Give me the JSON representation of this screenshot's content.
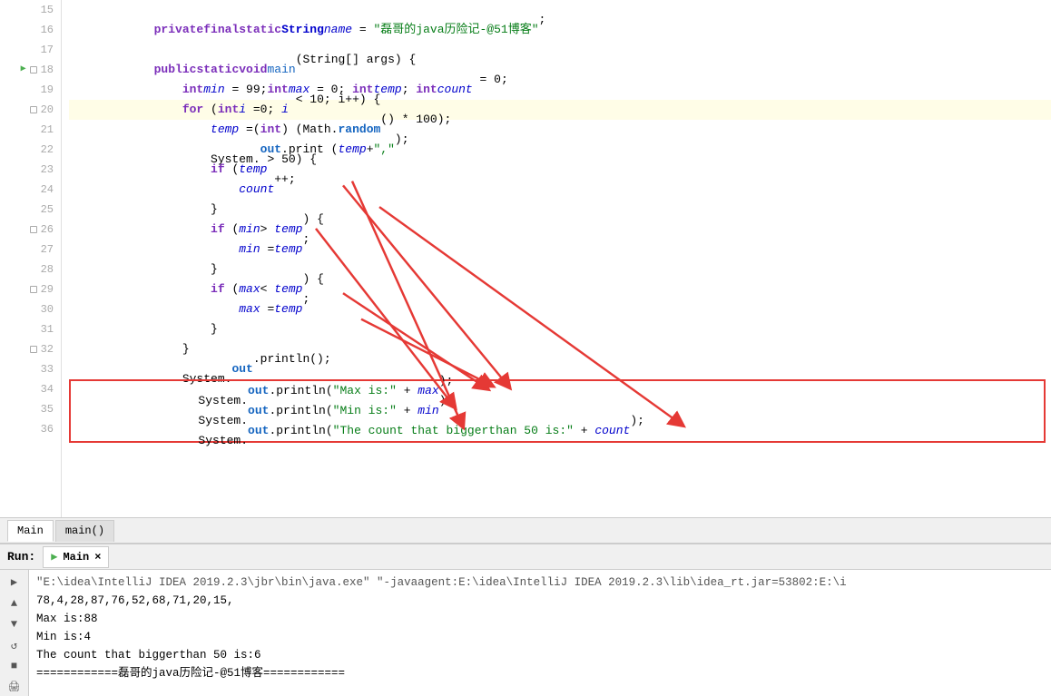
{
  "editor": {
    "lines": [
      {
        "num": 15,
        "content": "",
        "markers": []
      },
      {
        "num": 16,
        "content": "    private final static String name = \"磊哥的java历险记-@51博客\";",
        "markers": [],
        "highlighted": false
      },
      {
        "num": 17,
        "content": "",
        "markers": []
      },
      {
        "num": 18,
        "content": "    public static void main(String[] args) {",
        "markers": [
          "arrow-green"
        ],
        "highlighted": false
      },
      {
        "num": 19,
        "content": "        int min = 99;int max = 0; int temp; int count = 0;",
        "markers": [],
        "highlighted": false
      },
      {
        "num": 20,
        "content": "        for (int i =0; i < 10; i++) {",
        "markers": [],
        "highlighted": true
      },
      {
        "num": 21,
        "content": "            temp =(int) (Math.random() * 100);",
        "markers": [],
        "highlighted": false
      },
      {
        "num": 22,
        "content": "            System.out.print (temp+\",\");",
        "markers": [],
        "highlighted": false
      },
      {
        "num": 23,
        "content": "            if (temp> 50) {",
        "markers": [],
        "highlighted": false
      },
      {
        "num": 24,
        "content": "                count++;",
        "markers": [],
        "highlighted": false
      },
      {
        "num": 25,
        "content": "            }",
        "markers": [],
        "highlighted": false
      },
      {
        "num": 26,
        "content": "            if (min> temp) {",
        "markers": [],
        "highlighted": false
      },
      {
        "num": 27,
        "content": "                min =temp;",
        "markers": [],
        "highlighted": false
      },
      {
        "num": 28,
        "content": "            }",
        "markers": [],
        "highlighted": false
      },
      {
        "num": 29,
        "content": "            if (max< temp) {",
        "markers": [],
        "highlighted": false
      },
      {
        "num": 30,
        "content": "                max =temp;",
        "markers": [],
        "highlighted": false
      },
      {
        "num": 31,
        "content": "            }",
        "markers": [],
        "highlighted": false
      },
      {
        "num": 32,
        "content": "        }",
        "markers": [],
        "highlighted": false
      },
      {
        "num": 33,
        "content": "        System.out.println();",
        "markers": [],
        "highlighted": false
      },
      {
        "num": 34,
        "content": "        System.out.println(\"Max is:\" + max);",
        "markers": [],
        "highlighted": false,
        "boxed": "start"
      },
      {
        "num": 35,
        "content": "        System.out.println(\"Min is:\" + min);",
        "markers": [],
        "highlighted": false,
        "boxed": "mid"
      },
      {
        "num": 36,
        "content": "        System.out.println(\"The count that biggerthan 50 is:\" + count);",
        "markers": [],
        "highlighted": false,
        "boxed": "end"
      }
    ]
  },
  "tabs": {
    "bottom_tabs": [
      "Main",
      "main()"
    ],
    "active_tab": "Main"
  },
  "run": {
    "header_label": "Run:",
    "active_tab": "Main",
    "close_label": "×",
    "output_lines": [
      "\"E:\\idea\\IntelliJ IDEA 2019.2.3\\jbr\\bin\\java.exe\" \"-javaagent:E:\\idea\\IntelliJ IDEA 2019.2.3\\lib\\idea_rt.jar=53802:E:\\i",
      "78,4,28,87,76,52,68,71,20,15,",
      "Max is:88",
      "Min is:4",
      "The count that biggerthan 50 is:6",
      "============磊哥的java历险记-@51博客============"
    ]
  },
  "icons": {
    "play": "▶",
    "up": "▲",
    "down": "▼",
    "reload": "↺",
    "stop": "■",
    "print": "🖨"
  }
}
